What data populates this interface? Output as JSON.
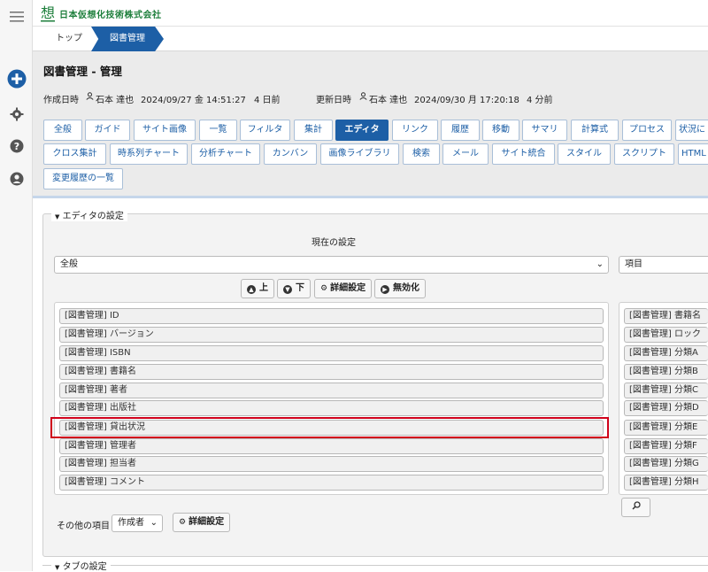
{
  "company": {
    "name": "日本仮想化技術株式会社",
    "logo_char": "想"
  },
  "breadcrumb": {
    "top": "トップ",
    "current": "図書管理"
  },
  "page": {
    "title": "図書管理 - 管理"
  },
  "meta": {
    "created_label": "作成日時",
    "created_user": "石本 達也",
    "created_at": "2024/09/27 金 14:51:27",
    "created_ago": "4 日前",
    "updated_label": "更新日時",
    "updated_user": "石本 達也",
    "updated_at": "2024/09/30 月 17:20:18",
    "updated_ago": "4 分前"
  },
  "tabs_row1": [
    "全般",
    "ガイド",
    "サイト画像",
    "一覧",
    "フィルタ",
    "集計",
    "エディタ",
    "リンク",
    "履歴",
    "移動",
    "サマリ",
    "計算式",
    "プロセス",
    "状況に"
  ],
  "tabs_row2": [
    "クロス集計",
    "時系列チャート",
    "分析チャート",
    "カンバン",
    "画像ライブラリ",
    "検索",
    "メール",
    "サイト統合",
    "スタイル",
    "スクリプト",
    "HTML"
  ],
  "tabs_row3": [
    "変更履歴の一覧"
  ],
  "active_tab": "エディタ",
  "editor": {
    "legend": "エディタの設定",
    "current_settings": "現在の設定",
    "section_select": "全般",
    "right_select": "項目",
    "btn_up": "上",
    "btn_down": "下",
    "btn_detail": "詳細設定",
    "btn_disable": "無効化",
    "left_items": [
      "[図書管理] ID",
      "[図書管理] バージョン",
      "[図書管理] ISBN",
      "[図書管理] 書籍名",
      "[図書管理] 著者",
      "[図書管理] 出版社",
      "[図書管理] 貸出状況",
      "[図書管理] 管理者",
      "[図書管理] 担当者",
      "[図書管理] コメント"
    ],
    "right_items": [
      "[図書管理] 書籍名",
      "[図書管理] ロック",
      "[図書管理] 分類A",
      "[図書管理] 分類B",
      "[図書管理] 分類C",
      "[図書管理] 分類D",
      "[図書管理] 分類E",
      "[図書管理] 分類F",
      "[図書管理] 分類G",
      "[図書管理] 分類H"
    ],
    "selected_item": "[図書管理] 貸出状況",
    "other_items_label": "その他の項目",
    "other_items_select": "作成者",
    "other_detail_button": "詳細設定"
  },
  "tab_settings_legend": "タブの設定",
  "colors": {
    "accent": "#1d5fa6",
    "highlight": "#d0021b",
    "logo": "#1e7f3c"
  }
}
